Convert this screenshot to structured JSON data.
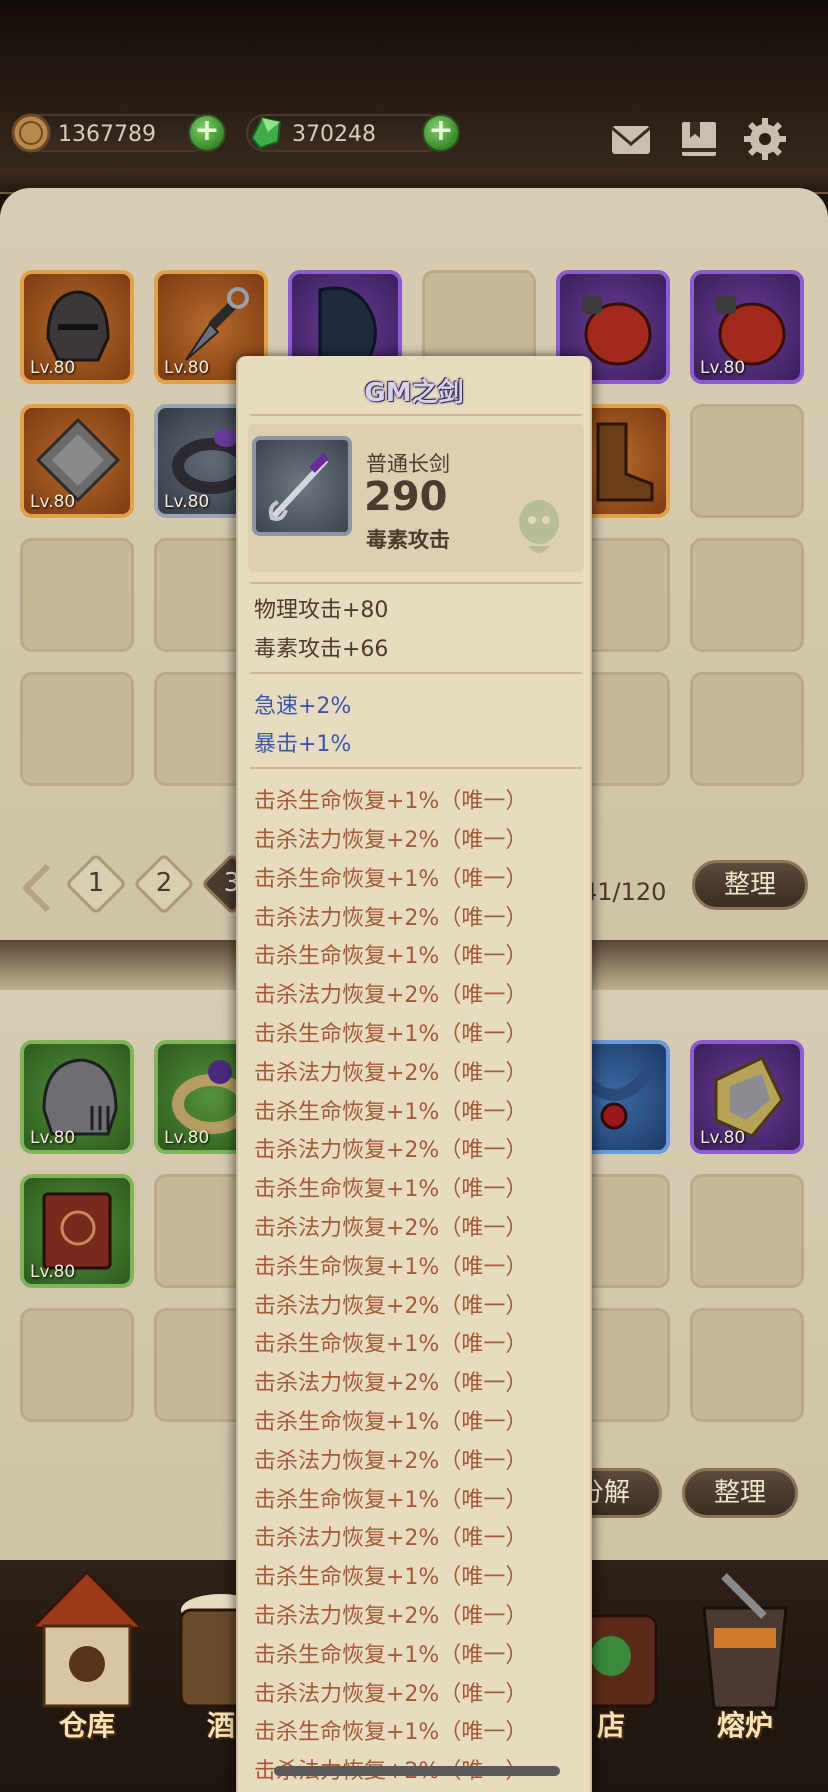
{
  "currencies": {
    "gold": {
      "value": "1367789",
      "icon": "gold-coin-icon"
    },
    "gems": {
      "value": "370248",
      "icon": "green-gem-icon"
    }
  },
  "top_icons": [
    "mail-icon",
    "bookmark-icon",
    "settings-gear-icon"
  ],
  "inventory_top": {
    "items": [
      {
        "rarity": "orange",
        "icon": "iron-helmet-icon",
        "level": "Lv.80"
      },
      {
        "rarity": "orange",
        "icon": "kunai-icon",
        "level": "Lv.80"
      },
      {
        "rarity": "purple",
        "icon": "dark-cloak-icon",
        "level": ""
      },
      {
        "rarity": "empty",
        "icon": "",
        "level": ""
      },
      {
        "rarity": "purple",
        "icon": "red-flask-icon",
        "level": "80"
      },
      {
        "rarity": "purple",
        "icon": "red-flask-icon",
        "level": "Lv.80"
      },
      {
        "rarity": "orange",
        "icon": "stone-block-icon",
        "level": "Lv.80"
      },
      {
        "rarity": "grey",
        "icon": "ring-icon",
        "level": "Lv.80"
      },
      {
        "rarity": "orange",
        "icon": "leather-boot-icon",
        "level": "80"
      }
    ],
    "pager": {
      "pages": [
        "1",
        "2",
        "3"
      ],
      "counter": "41/120",
      "sort_label": "整理"
    }
  },
  "inventory_bottom": {
    "items": [
      {
        "rarity": "green",
        "icon": "knight-helmet-icon",
        "level": "Lv.80"
      },
      {
        "rarity": "green",
        "icon": "gem-ring-icon",
        "level": "Lv.80"
      },
      {
        "rarity": "blue",
        "icon": "amulet-icon",
        "level": "80"
      },
      {
        "rarity": "purple",
        "icon": "golden-helmet-icon",
        "level": "Lv.80"
      },
      {
        "rarity": "green",
        "icon": "spellbook-icon",
        "level": "Lv.80"
      }
    ],
    "decompose_label": "分解",
    "sort_label": "整理"
  },
  "tooltip": {
    "title": "GM之剑",
    "weapon_type": "普通长剑",
    "power": "290",
    "element": "毒素攻击",
    "base_stats": [
      "物理攻击+80",
      "毒素攻击+66"
    ],
    "secondary_stats": [
      "急速+2%",
      "暴击+1%"
    ],
    "unique_stats": [
      "击杀生命恢复+1%（唯一）",
      "击杀法力恢复+2%（唯一）",
      "击杀生命恢复+1%（唯一）",
      "击杀法力恢复+2%（唯一）",
      "击杀生命恢复+1%（唯一）",
      "击杀法力恢复+2%（唯一）",
      "击杀生命恢复+1%（唯一）",
      "击杀法力恢复+2%（唯一）",
      "击杀生命恢复+1%（唯一）",
      "击杀法力恢复+2%（唯一）",
      "击杀生命恢复+1%（唯一）",
      "击杀法力恢复+2%（唯一）",
      "击杀生命恢复+1%（唯一）",
      "击杀法力恢复+2%（唯一）",
      "击杀生命恢复+1%（唯一）",
      "击杀法力恢复+2%（唯一）",
      "击杀生命恢复+1%（唯一）",
      "击杀法力恢复+2%（唯一）",
      "击杀生命恢复+1%（唯一）",
      "击杀法力恢复+2%（唯一）",
      "击杀生命恢复+1%（唯一）",
      "击杀法力恢复+2%（唯一）",
      "击杀生命恢复+1%（唯一）",
      "击杀法力恢复+2%（唯一）",
      "击杀生命恢复+1%（唯一）",
      "击杀法力恢复+2%（唯一）"
    ]
  },
  "bottom_nav": [
    {
      "label": "仓库",
      "icon": "warehouse-icon"
    },
    {
      "label": "酒",
      "icon": "tavern-barrel-icon"
    },
    {
      "label": "店",
      "icon": "shop-icon"
    },
    {
      "label": "熔炉",
      "icon": "furnace-icon"
    }
  ]
}
